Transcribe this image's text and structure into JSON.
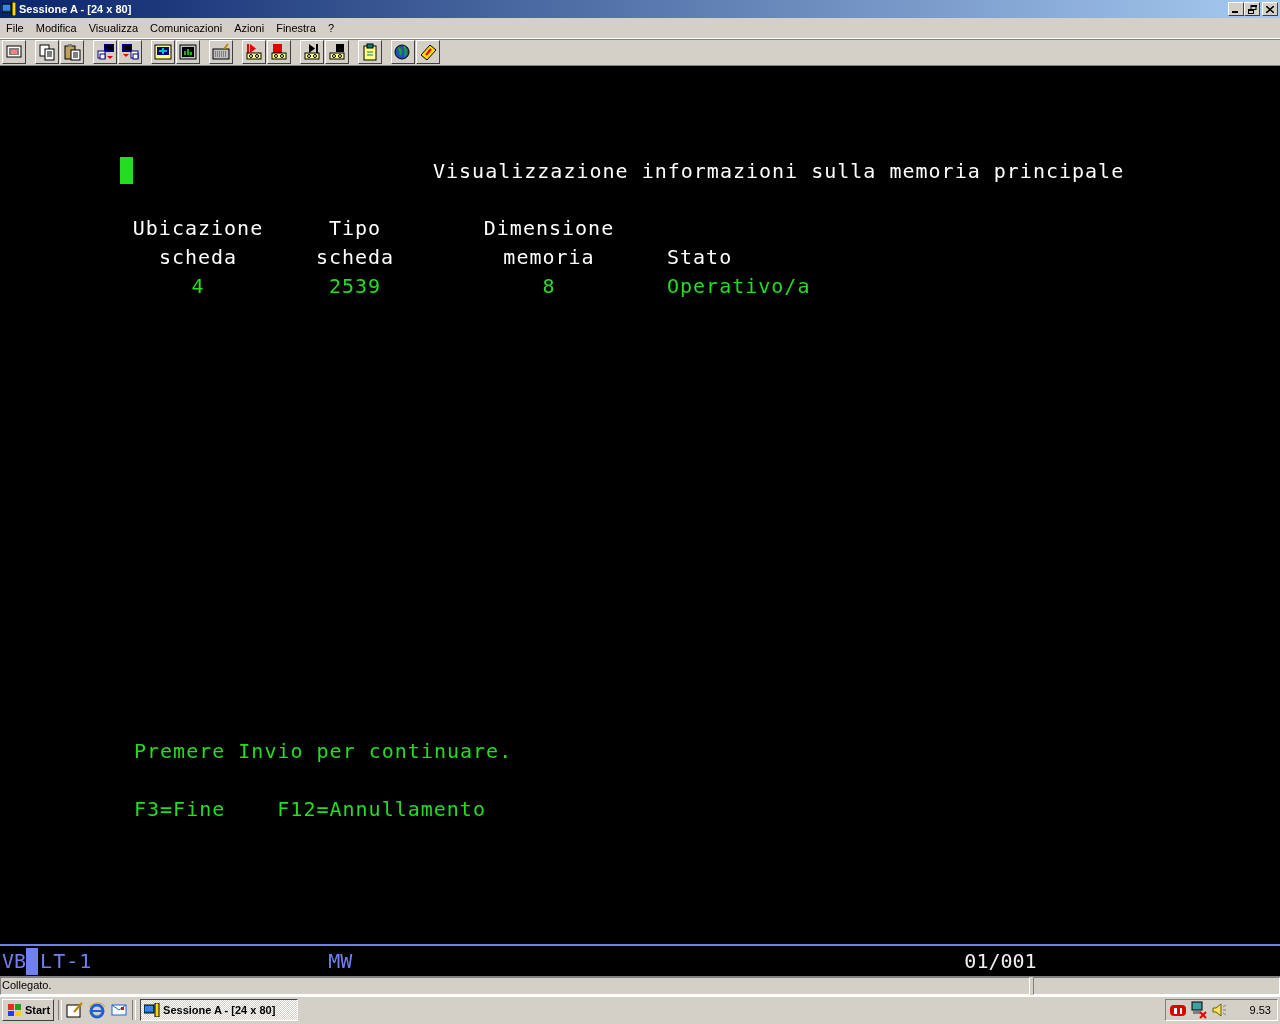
{
  "window": {
    "title": "Sessione A - [24 x 80]"
  },
  "menu": [
    "File",
    "Modifica",
    "Visualizza",
    "Comunicazioni",
    "Azioni",
    "Finestra",
    "?"
  ],
  "terminal": {
    "title": "Visualizzazione informazioni sulla memoria principale",
    "columns": [
      {
        "heading": [
          "Ubicazione",
          "scheda"
        ],
        "value": "4"
      },
      {
        "heading": [
          "Tipo",
          "scheda"
        ],
        "value": "2539"
      },
      {
        "heading": [
          "Dimensione",
          "memoria"
        ],
        "value": "8"
      },
      {
        "heading": [
          "Stato"
        ],
        "value": "Operativo/a"
      }
    ],
    "prompt": "Premere Invio per continuare.",
    "function_keys": [
      "F3=Fine",
      "F12=Annullamento"
    ]
  },
  "oia": {
    "indicator": "VB",
    "status": "LT-1",
    "mode": "MW",
    "cursor_position": "01/001"
  },
  "status_bar": {
    "text": "Collegato."
  },
  "taskbar": {
    "start": "Start",
    "tasks": [
      {
        "label": "Sessione A - [24 x 80]",
        "selected": true
      }
    ],
    "clock": "9.53"
  }
}
